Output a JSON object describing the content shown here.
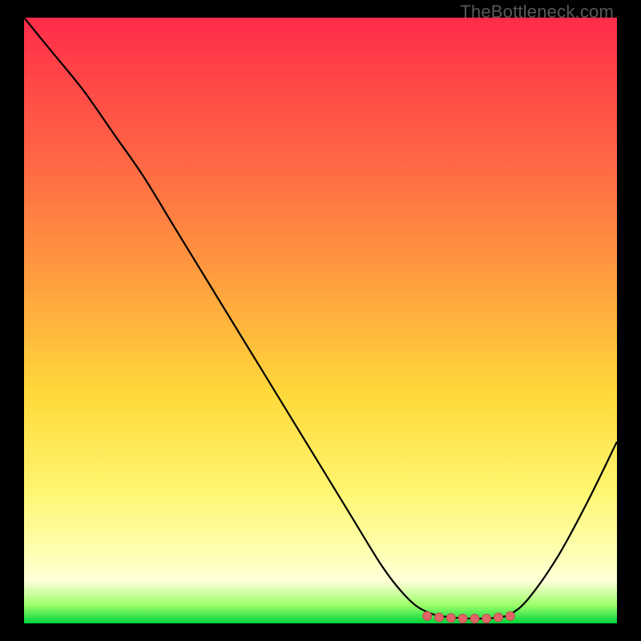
{
  "watermark": "TheBottleneck.com",
  "colors": {
    "frame": "#000000",
    "curve_stroke": "#000000",
    "marker_fill": "#e06666",
    "marker_stroke": "#c44d4d",
    "gradient_top": "#ff2b49",
    "gradient_bottom": "#00d43a"
  },
  "chart_data": {
    "type": "line",
    "title": "",
    "xlabel": "",
    "ylabel": "",
    "xlim": [
      0,
      100
    ],
    "ylim": [
      0,
      100
    ],
    "x": [
      0,
      5,
      10,
      15,
      20,
      25,
      30,
      35,
      40,
      45,
      50,
      55,
      60,
      63,
      66,
      69,
      72,
      75,
      78,
      80,
      82,
      85,
      90,
      95,
      100
    ],
    "y": [
      100,
      94,
      88,
      81,
      74,
      66,
      58,
      50,
      42,
      34,
      26,
      18,
      10,
      6,
      3,
      1.5,
      1,
      0.8,
      0.8,
      1,
      1.5,
      4,
      11,
      20,
      30
    ],
    "markers": {
      "x": [
        68,
        70,
        72,
        74,
        76,
        78,
        80,
        82
      ],
      "y": [
        1.2,
        1.0,
        0.9,
        0.8,
        0.8,
        0.8,
        1.0,
        1.2
      ]
    }
  }
}
